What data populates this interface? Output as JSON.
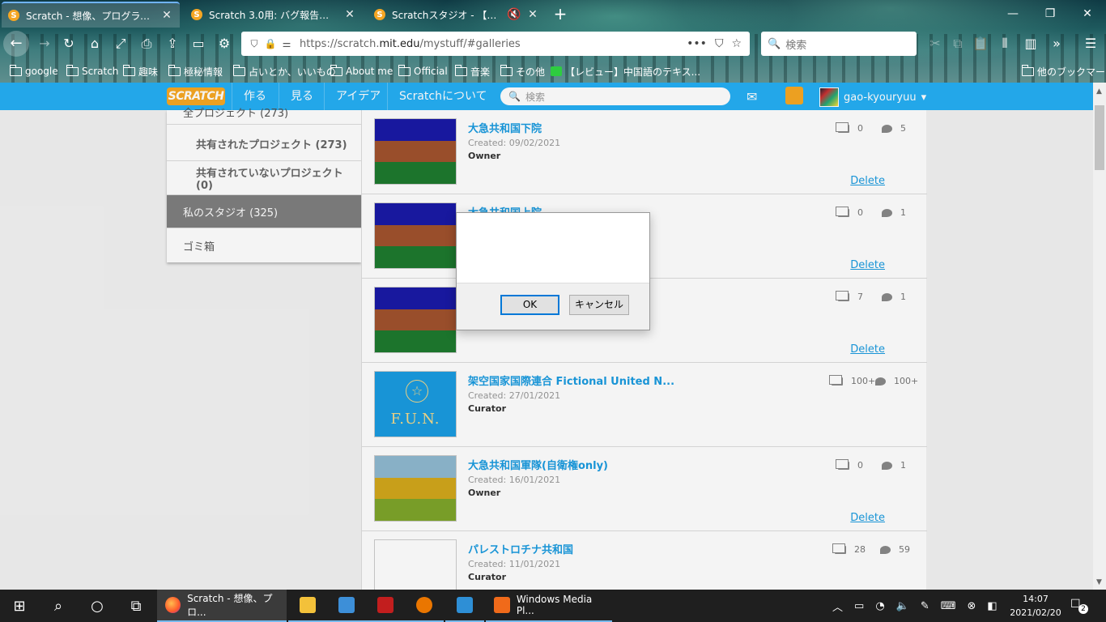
{
  "browser": {
    "tabs": [
      {
        "title": "Scratch - 想像、プログラム、共有",
        "icon": "scratch-favicon"
      },
      {
        "title": "Scratch 3.0用: バグ報告コーナー",
        "icon": "scratch-favicon"
      },
      {
        "title": "Scratchスタジオ - 【閉鎖】S.U",
        "icon": "scratch-favicon"
      }
    ],
    "url_prefix": "https://scratch.",
    "url_domain": "mit.edu",
    "url_path": "/mystuff/#galleries",
    "search_placeholder": "検索",
    "bookmarks": [
      "google",
      "Scratch",
      "趣味",
      "極秘情報",
      "占いとか、いいもの",
      "About me",
      "Official",
      "音楽",
      "その他",
      "【レビュー】中国語のテキス...",
      "他のブックマーク"
    ]
  },
  "scratch": {
    "logo": "SCRATCH",
    "nav": [
      "作る",
      "見る",
      "アイデア",
      "Scratchについて"
    ],
    "search_placeholder": "検索",
    "username": "gao-kyouryuu",
    "sidebar": {
      "partial_top": "全プロジェクト (273)",
      "shared": "共有されたプロジェクト (273)",
      "unshared": "共有されていないプロジェクト (0)",
      "studios": "私のスタジオ (325)",
      "trash": "ゴミ箱"
    },
    "studios": [
      {
        "title": "大急共和国下院",
        "created": "Created: 09/02/2021",
        "role": "Owner",
        "projects": "0",
        "comments": "5",
        "delete": "Delete"
      },
      {
        "title": "大急共和国上院",
        "created": "",
        "role": "",
        "projects": "0",
        "comments": "1",
        "delete": "Delete"
      },
      {
        "title": "",
        "created": "",
        "role": "",
        "projects": "7",
        "comments": "1",
        "delete": "Delete"
      },
      {
        "title": "架空国家国際連合  Fictional United N...",
        "created": "Created: 27/01/2021",
        "role": "Curator",
        "projects": "100+",
        "comments": "100+",
        "thumb_text": "F.U.N."
      },
      {
        "title": "大急共和国軍隊(自衛権only)",
        "created": "Created: 16/01/2021",
        "role": "Owner",
        "projects": "0",
        "comments": "1",
        "delete": "Delete"
      },
      {
        "title": "パレストロチナ共和国",
        "created": "Created: 11/01/2021",
        "role": "Curator",
        "projects": "28",
        "comments": "59"
      }
    ]
  },
  "dialog": {
    "message": "",
    "ok": "OK",
    "cancel": "キャンセル"
  },
  "taskbar": {
    "firefox_label": "Scratch - 想像、プロ...",
    "wmp_label": "Windows Media Pl...",
    "time": "14:07",
    "date": "2021/02/20",
    "notifications": "2"
  },
  "colors": {
    "scratch_blue": "#25aff4",
    "link_blue": "#1a9be0",
    "scratch_orange": "#f7a823"
  }
}
